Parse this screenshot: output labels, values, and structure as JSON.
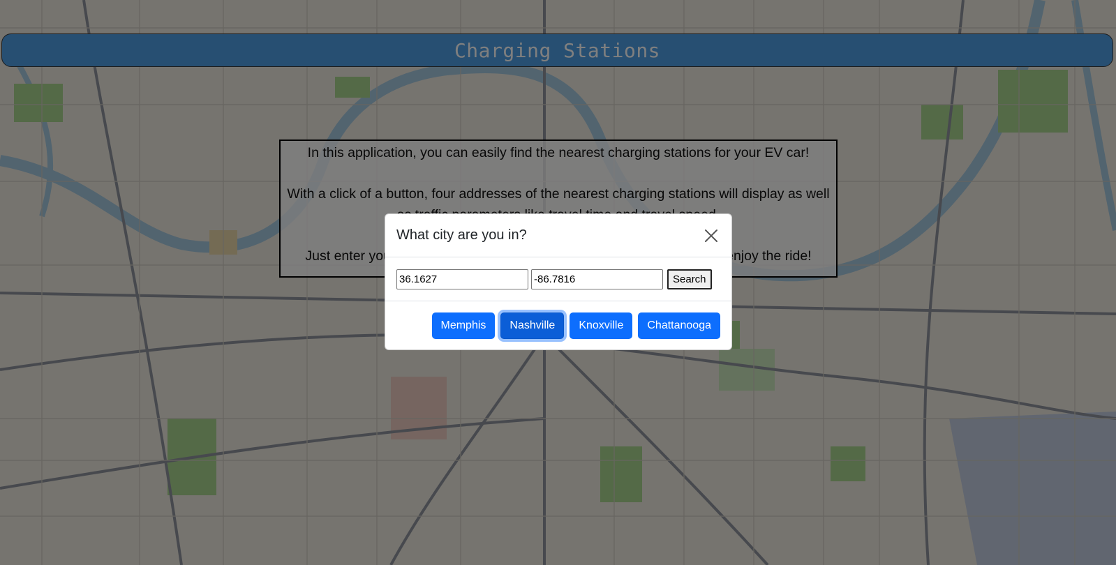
{
  "header": {
    "title": "Charging Stations"
  },
  "intro": {
    "lines": [
      "In this application, you can easily find the nearest charging stations for your EV car!",
      "With a click of a button, four addresses of the nearest charging stations will display as well as traffic parameters like travel time and travel speed.",
      "Just enter your location or choose one of the cities to get started, and enjoy the ride!"
    ]
  },
  "modal": {
    "title": "What city are you in?",
    "latitude_value": "36.1627",
    "longitude_value": "-86.7816",
    "search_label": "Search",
    "cities": [
      "Memphis",
      "Nashville",
      "Knoxville",
      "Chattanooga"
    ],
    "selected_city": "Nashville"
  },
  "colors": {
    "header_bg": "#4f9fe5",
    "primary_button": "#0d6efd",
    "backdrop": "rgba(0,0,0,0.5)"
  },
  "icons": {
    "close": "close-icon"
  }
}
